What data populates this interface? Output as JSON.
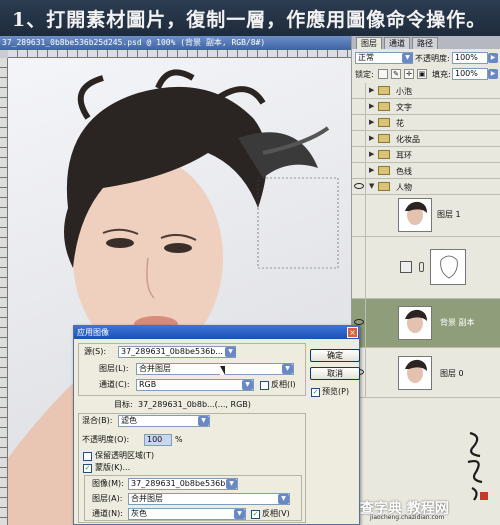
{
  "banner": {
    "text": "1、打開素材圖片，復制一層，作應用圖像命令操作。"
  },
  "document": {
    "title": "37_289631_0b8be536b25d245.psd @ 100% (背景 副本, RGB/8#)"
  },
  "layers_panel": {
    "tabs": [
      "图层",
      "通道",
      "路径"
    ],
    "active_tab": "图层",
    "blend_mode": "正常",
    "opacity_label": "不透明度:",
    "opacity_value": "100%",
    "lock_label": "锁定:",
    "fill_label": "填充:",
    "fill_value": "100%",
    "groups": [
      "小泡",
      "文字",
      "花",
      "化妆品",
      "耳环",
      "色线",
      "人物"
    ],
    "layers": [
      {
        "name": "图层 1",
        "selected": false
      },
      {
        "name": "",
        "selected": false
      },
      {
        "name": "背景 副本",
        "selected": true
      },
      {
        "name": "图层 0",
        "selected": false
      }
    ]
  },
  "dialog": {
    "title": "应用图像",
    "source_label": "源(S):",
    "source_value": "37_289631_0b8be536b...",
    "layer_label": "图层(L):",
    "layer_value": "合并图层",
    "channel_label": "通道(C):",
    "channel_value": "RGB",
    "invert_label": "反相(I)",
    "target_label": "目标:",
    "target_value": "37_289631_0b8b...(..., RGB)",
    "blending_label": "混合(B):",
    "blending_value": "滤色",
    "opacity_label": "不透明度(O):",
    "opacity_value": "100",
    "opacity_unit": "%",
    "preserve_label": "保留透明区域(T)",
    "mask_label": "蒙版(K)...",
    "mask_image_label": "图像(M):",
    "mask_image_value": "37_289631_0b8be536b...",
    "mask_layer_label": "图层(A):",
    "mask_layer_value": "合并图层",
    "mask_channel_label": "通道(N):",
    "mask_channel_value": "灰色",
    "mask_invert_label": "反相(V)",
    "ok_label": "确定",
    "cancel_label": "取消",
    "preview_label": "预览(P)"
  },
  "watermark": {
    "main": "查字典 教程网",
    "sub": "jiaocheng.chazidian.com"
  },
  "colors": {
    "banner": "#253447",
    "selected_layer": "#8f9d7a",
    "dialog_title": "#1c50b3"
  }
}
